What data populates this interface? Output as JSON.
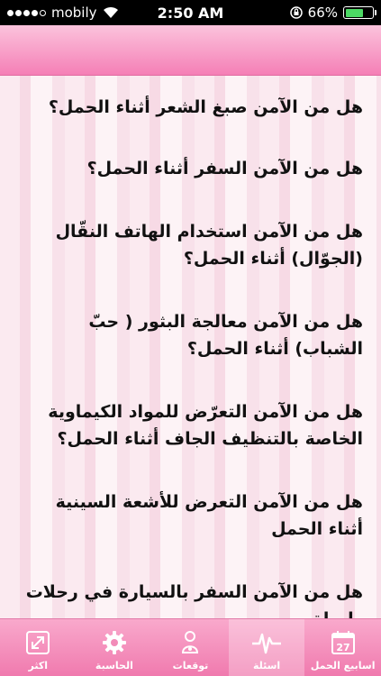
{
  "status_bar": {
    "carrier": "mobily",
    "time": "2:50 AM",
    "battery": "66%",
    "battery_level": 0.66
  },
  "questions": [
    "هل من الآمن صبغ الشعر أثناء الحمل؟",
    "هل من الآمن السفر أثناء الحمل؟",
    "هل من الآمن استخدام الهاتف النقّال (الجوّال) أثناء الحمل؟",
    "هل من الآمن معالجة البثور ( حبّ الشباب) أثناء الحمل؟",
    "هل من الآمن التعرّض للمواد الكيماوية الخاصة بالتنظيف الجاف أثناء الحمل؟",
    "هل من الآمن التعرض للأشعة السينية أثناء الحمل",
    "هل من الآمن السفر بالسيارة في رحلات طويلة"
  ],
  "tabs": [
    {
      "label": "اكثر",
      "icon": "expand-icon"
    },
    {
      "label": "الحاسبة",
      "icon": "gear-icon"
    },
    {
      "label": "توقعات",
      "icon": "baby-icon"
    },
    {
      "label": "اسئلة",
      "icon": "heartbeat-icon",
      "active": true
    },
    {
      "label": "اسابيع الحمل",
      "icon": "calendar-icon",
      "calendar_number": "27"
    }
  ]
}
